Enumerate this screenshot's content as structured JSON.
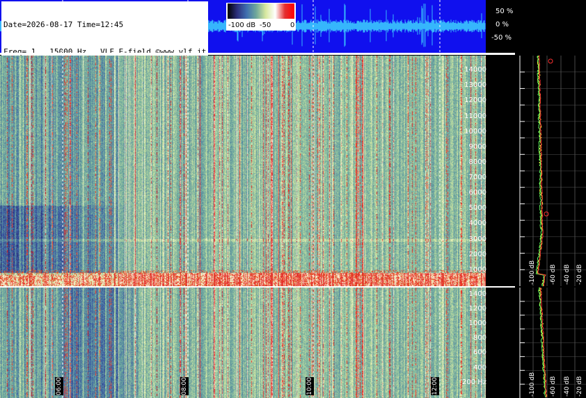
{
  "header": {
    "date_line": "Date=2026-08-17 Time=12:45",
    "freq_line": "Freq= 1...15000 Hz   VLF E-field ©www.vlf.it"
  },
  "colorbar": {
    "labels": [
      "-100 dB",
      "-50",
      "0"
    ]
  },
  "waveform": {
    "labels": [
      "50 %",
      "0 %",
      "-50 %"
    ],
    "background_color": "#1010ee",
    "trace_color": "#40e0ff"
  },
  "chart_data": [
    {
      "type": "heatmap",
      "title": "",
      "xlabel": "",
      "ylabel": "",
      "y_ticks": [
        "14000",
        "13000",
        "12000",
        "11000",
        "10000",
        "9000",
        "8000",
        "7000",
        "6000",
        "5000",
        "4000",
        "3000",
        "2000",
        "1000"
      ],
      "ylim": [
        0,
        15000
      ],
      "x_time_labels": [
        "06:00",
        "08:00",
        "10:00",
        "12:00"
      ],
      "colorscale": [
        "#000000",
        "#2b2f7c",
        "#3f6fb0",
        "#6fa89a",
        "#d8e8a0",
        "#ffffff",
        "#e33030",
        "#ff0000"
      ],
      "spectrum_ticks_db": [
        "-100 dB",
        "-60 dB",
        "-40 dB",
        "-20 dB"
      ]
    },
    {
      "type": "heatmap",
      "title": "",
      "y_ticks": [
        "1400",
        "1200",
        "1000",
        "800",
        "600",
        "400",
        "200 Hz"
      ],
      "ylim": [
        0,
        1500
      ],
      "spectrum_ticks_db": [
        "-100 dB",
        "-60 dB",
        "-40 dB",
        "-20 dB"
      ]
    }
  ]
}
